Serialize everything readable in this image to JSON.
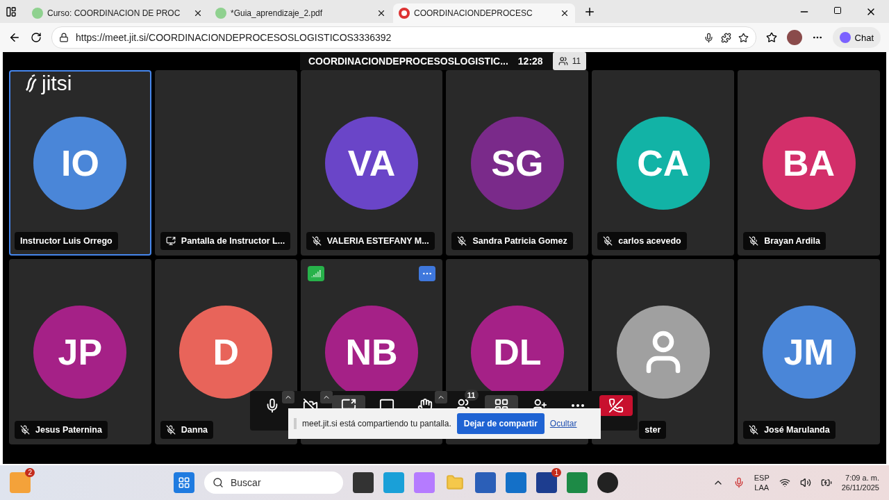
{
  "browser": {
    "tabs": [
      {
        "title": "Curso: COORDINACION DE PROC",
        "kind": "site",
        "selected": false
      },
      {
        "title": "*Guia_aprendizaje_2.pdf",
        "kind": "site",
        "selected": false
      },
      {
        "title": "COORDINACIONDEPROCESC",
        "kind": "recording",
        "selected": true
      }
    ],
    "url": "https://meet.jit.si/COORDINACIONDEPROCESOSLOGISTICOS3336392",
    "chat_label": "Chat"
  },
  "meeting": {
    "logo": "jitsi",
    "title": "COORDINACIONDEPROCESOSLOGISTIC...",
    "time": "12:28",
    "participant_count": "11",
    "tiles": [
      {
        "kind": "avatar",
        "initials": "IO",
        "color": "#4a86d8",
        "name": "Instructor Luis Orrego",
        "muted": false,
        "selected": true,
        "hovered": false
      },
      {
        "kind": "screen",
        "name": "Pantalla de Instructor L...",
        "muted": false,
        "selected": false,
        "hovered": false
      },
      {
        "kind": "avatar",
        "initials": "VA",
        "color": "#6a45c8",
        "name": "VALERIA ESTEFANY M...",
        "muted": true,
        "selected": false,
        "hovered": false
      },
      {
        "kind": "avatar",
        "initials": "SG",
        "color": "#7a2a8a",
        "name": "Sandra Patricia Gomez",
        "muted": true,
        "selected": false,
        "hovered": false
      },
      {
        "kind": "avatar",
        "initials": "CA",
        "color": "#12b3a6",
        "name": "carlos acevedo",
        "muted": true,
        "selected": false,
        "hovered": false
      },
      {
        "kind": "avatar",
        "initials": "BA",
        "color": "#d32f6a",
        "name": "Brayan Ardila",
        "muted": true,
        "selected": false,
        "hovered": false
      },
      {
        "kind": "avatar",
        "initials": "JP",
        "color": "#a52187",
        "name": "Jesus Paternina",
        "muted": true,
        "selected": false,
        "hovered": false
      },
      {
        "kind": "avatar",
        "initials": "D",
        "color": "#e8645a",
        "name": "Danna",
        "muted": true,
        "selected": false,
        "hovered": false
      },
      {
        "kind": "avatar",
        "initials": "NB",
        "color": "#a52187",
        "selected": false,
        "hovered": true
      },
      {
        "kind": "avatar",
        "initials": "DL",
        "color": "#a52187",
        "selected": false,
        "hovered": false
      },
      {
        "kind": "generic",
        "color": "#a0a0a0",
        "name": "ster",
        "muted": false,
        "selected": false,
        "hovered": false
      },
      {
        "kind": "avatar",
        "initials": "JM",
        "color": "#4a86d8",
        "name": "José Marulanda",
        "muted": true,
        "selected": false,
        "hovered": false
      }
    ],
    "toolbar": {
      "participants_badge": "11"
    },
    "share_notice": {
      "message": "meet.jit.si está compartiendo tu pantalla.",
      "stop_button": "Dejar de compartir",
      "hide_link": "Ocultar"
    }
  },
  "taskbar": {
    "weather_badge": "2",
    "search_placeholder": "Buscar",
    "app_badge": "1",
    "language": "ESP",
    "layout": "LAA",
    "time": "7:09 a. m.",
    "date": "26/11/2025"
  }
}
